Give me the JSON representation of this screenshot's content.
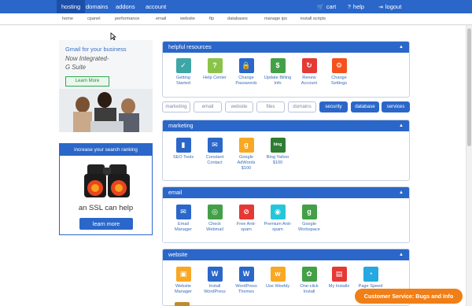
{
  "topnav": {
    "tabs": [
      {
        "label": "hosting"
      },
      {
        "label": "domains"
      },
      {
        "label": "addons"
      },
      {
        "label": "account"
      }
    ],
    "cart": "cart",
    "help": "help",
    "logout": "logout"
  },
  "subnav": [
    "home",
    "cpanel",
    "performance",
    "email",
    "website",
    "ftp",
    "databases",
    "manage ips",
    "install scripts"
  ],
  "ads": {
    "gmail": {
      "line1": "Gmail for your business",
      "line2": "Now Integrated-",
      "line3": "G Suite",
      "button": "Learn More"
    },
    "ssl": {
      "header": "increase your search ranking",
      "tagline": "an SSL can help",
      "button": "learn more"
    }
  },
  "helpful": {
    "title": "helpful resources",
    "tiles": [
      {
        "label": "Getting Started",
        "icon": "check-icon",
        "color": "#3fa6a6"
      },
      {
        "label": "Help Center",
        "icon": "question-icon",
        "color": "#8bc34a"
      },
      {
        "label": "Change Passwords",
        "icon": "lock-icon",
        "color": "#2b67c9"
      },
      {
        "label": "Update Billing Info",
        "icon": "billing-icon",
        "color": "#43a047"
      },
      {
        "label": "Renew Account",
        "icon": "renew-icon",
        "color": "#e53935"
      },
      {
        "label": "Change Settings",
        "icon": "gear-icon",
        "color": "#f4511e"
      }
    ]
  },
  "filters": [
    {
      "label": "marketing",
      "active": false
    },
    {
      "label": "email",
      "active": false
    },
    {
      "label": "website",
      "active": false
    },
    {
      "label": "files",
      "active": false
    },
    {
      "label": "domains",
      "active": false
    },
    {
      "label": "security",
      "active": true
    },
    {
      "label": "database",
      "active": true
    },
    {
      "label": "services",
      "active": true
    }
  ],
  "marketing": {
    "title": "marketing",
    "tiles": [
      {
        "label": "SEO Tools",
        "icon": "chart-icon",
        "color": "#2b67c9"
      },
      {
        "label": "Constant Contact",
        "icon": "envelope-icon",
        "color": "#2b67c9"
      },
      {
        "label": "Google AdWords $100",
        "icon": "google-icon",
        "color": "#f9a825"
      },
      {
        "label": "Bing Yahoo $100",
        "icon": "bing-icon",
        "color": "#2e7d32"
      }
    ]
  },
  "email": {
    "title": "email",
    "tiles": [
      {
        "label": "Email Manager",
        "icon": "person-mail-icon",
        "color": "#2b67c9"
      },
      {
        "label": "Check Webmail",
        "icon": "globe-icon",
        "color": "#43a047"
      },
      {
        "label": "Free Anti-spam",
        "icon": "shield-icon",
        "color": "#e53935"
      },
      {
        "label": "Premium Anti-spam",
        "icon": "shield-icon",
        "color": "#26c6da"
      },
      {
        "label": "Google Workspace",
        "icon": "google-icon",
        "color": "#43a047"
      }
    ]
  },
  "website": {
    "title": "website",
    "tiles": [
      {
        "label": "Website Manager",
        "icon": "website-icon",
        "color": "#f9a825"
      },
      {
        "label": "Install WordPress",
        "icon": "wordpress-icon",
        "color": "#2b67c9"
      },
      {
        "label": "WordPress Themes",
        "icon": "wordpress-icon",
        "color": "#2b67c9"
      },
      {
        "label": "Use Weebly",
        "icon": "weebly-icon",
        "color": "#f9a825"
      },
      {
        "label": "One-click Install",
        "icon": "mojo-icon",
        "color": "#43a047"
      },
      {
        "label": "My Installs",
        "icon": "installs-icon",
        "color": "#e53935"
      },
      {
        "label": "Page Speed",
        "icon": "speed-icon",
        "color": "#26a9e0"
      }
    ]
  },
  "customer_service": "Customer Service: Bugs and Info",
  "colors": {
    "brand": "#2b67c9",
    "accent": "#f07f17"
  }
}
